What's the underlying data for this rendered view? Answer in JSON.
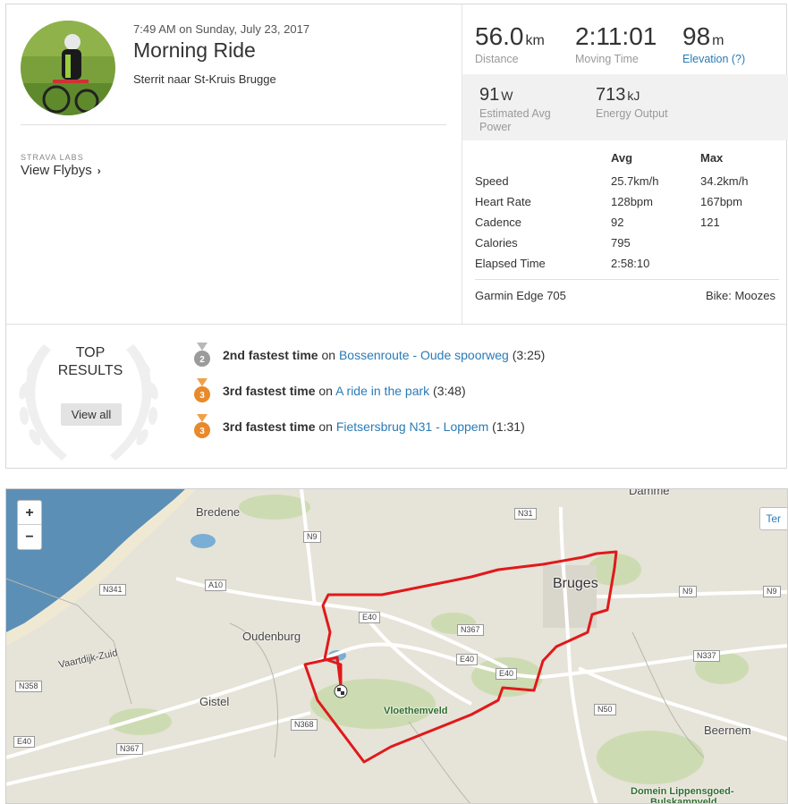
{
  "activity": {
    "datetime": "7:49 AM on Sunday, July 23, 2017",
    "title": "Morning Ride",
    "description": "Sterrit naar St-Kruis Brugge"
  },
  "labs": {
    "label": "STRAVA LABS",
    "link": "View Flybys"
  },
  "primary_stats": [
    {
      "value": "56.0",
      "unit": "km",
      "label": "Distance"
    },
    {
      "value": "2:11:01",
      "unit": "",
      "label": "Moving Time"
    },
    {
      "value": "98",
      "unit": "m",
      "label": "Elevation (?)"
    }
  ],
  "secondary_stats": [
    {
      "value": "91",
      "unit": "W",
      "label": "Estimated Avg Power"
    },
    {
      "value": "713",
      "unit": "kJ",
      "label": "Energy Output"
    }
  ],
  "stats_table": {
    "headers": {
      "avg": "Avg",
      "max": "Max"
    },
    "rows": [
      {
        "label": "Speed",
        "avg": "25.7km/h",
        "max": "34.2km/h"
      },
      {
        "label": "Heart Rate",
        "avg": "128bpm",
        "max": "167bpm"
      },
      {
        "label": "Cadence",
        "avg": "92",
        "max": "121"
      },
      {
        "label": "Calories",
        "avg": "795",
        "max": ""
      },
      {
        "label": "Elapsed Time",
        "avg": "2:58:10",
        "max": ""
      }
    ]
  },
  "device": "Garmin Edge 705",
  "bike": "Bike: Moozes",
  "top_results": {
    "title_line1": "TOP",
    "title_line2": "RESULTS",
    "view_all": "View all",
    "items": [
      {
        "medal": "2",
        "medal_color": "#9b9b9b",
        "rank": "2nd fastest time",
        "on": "on",
        "segment": "Bossenroute - Oude spoorweg",
        "time": "(3:25)"
      },
      {
        "medal": "3",
        "medal_color": "#e8892b",
        "rank": "3rd fastest time",
        "on": "on",
        "segment": "A ride in the park",
        "time": "(3:48)"
      },
      {
        "medal": "3",
        "medal_color": "#e8892b",
        "rank": "3rd fastest time",
        "on": "on",
        "segment": "Fietsersbrug N31 - Loppem",
        "time": "(1:31)"
      }
    ]
  },
  "map": {
    "zoom_in": "+",
    "zoom_out": "−",
    "terrain_button": "Ter",
    "route_color": "#e0191b",
    "places": {
      "damme": "Damme",
      "bredene": "Bredene",
      "oudenburg": "Oudenburg",
      "gistel": "Gistel",
      "bruges": "Bruges",
      "beernem": "Beernem",
      "vaartdijk": "Vaartdijk-Zuid",
      "vloethemveld": "Vloethemveld",
      "domein": "Domein Lippensgoed-",
      "domein2": "Bulskampveld"
    },
    "roads": {
      "n31": "N31",
      "n9a": "N9",
      "n341": "N341",
      "a10": "A10",
      "e40a": "E40",
      "n367a": "N367",
      "e40b": "E40",
      "e40c": "E40",
      "n9b": "N9",
      "n9c": "N9",
      "n337": "N337",
      "n358": "N358",
      "n368": "N368",
      "e40d": "E40",
      "n367b": "N367",
      "n50": "N50"
    }
  }
}
